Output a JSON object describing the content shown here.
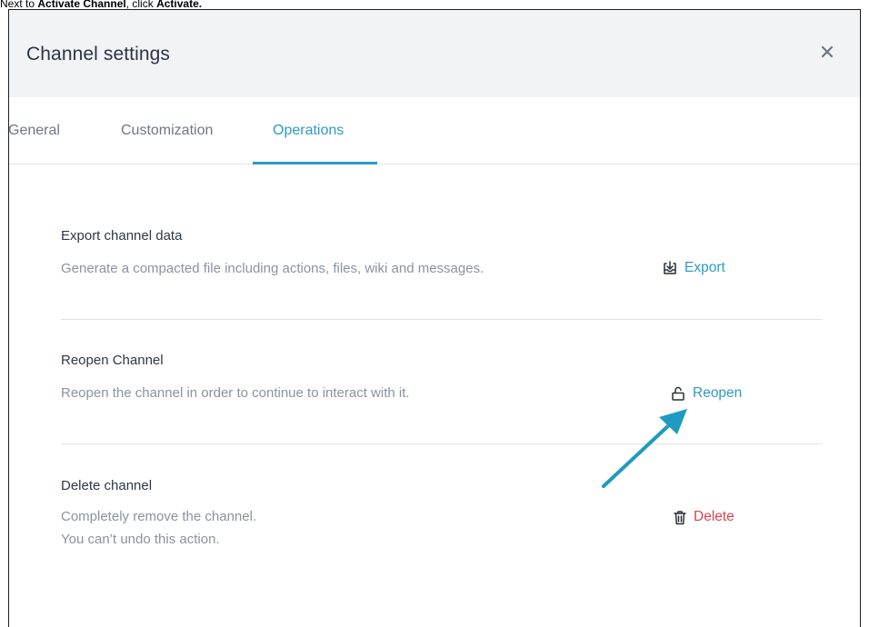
{
  "instruction": {
    "prefix": "Next to ",
    "bold1": "Activate Channel",
    "middle": ", click ",
    "bold2": "Activate."
  },
  "dialog": {
    "title": "Channel settings",
    "close_icon": "close-icon"
  },
  "tabs": [
    {
      "label": "General"
    },
    {
      "label": "Customization"
    },
    {
      "label": "Operations",
      "active": true
    }
  ],
  "sections": {
    "export": {
      "title": "Export channel data",
      "description": "Generate a compacted file including actions, files, wiki and messages.",
      "action_label": "Export",
      "icon": "export-icon"
    },
    "reopen": {
      "title": "Reopen Channel",
      "description": "Reopen the channel in order to continue to interact with it.",
      "action_label": "Reopen",
      "icon": "unlock-icon"
    },
    "delete": {
      "title": "Delete channel",
      "description_line1": "Completely remove the channel.",
      "description_line2": "You can’t undo this action.",
      "action_label": "Delete",
      "icon": "trash-icon"
    }
  },
  "colors": {
    "accent": "#2d9ac4",
    "danger": "#d9434e",
    "annotation_arrow": "#1f9ac0"
  }
}
